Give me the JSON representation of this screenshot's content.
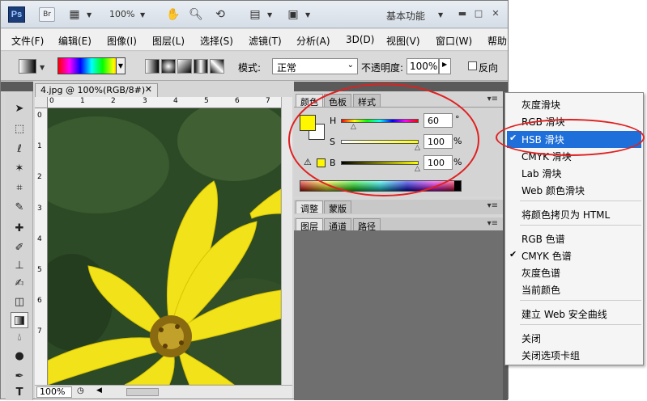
{
  "titlebar": {
    "logo": "Ps",
    "bridge": "Br",
    "zoom": "100%",
    "workspace": "基本功能"
  },
  "menubar": {
    "items": [
      "文件(F)",
      "编辑(E)",
      "图像(I)",
      "图层(L)",
      "选择(S)",
      "滤镜(T)",
      "分析(A)",
      "3D(D)",
      "视图(V)",
      "窗口(W)",
      "帮助"
    ]
  },
  "options": {
    "mode_label": "模式:",
    "mode_value": "正常",
    "opacity_label": "不透明度:",
    "opacity_value": "100%",
    "reverse_label": "反向"
  },
  "document": {
    "tab_title": "4.jpg @ 100%(RGB/8#)",
    "zoom": "100%",
    "ruler_h": [
      "0",
      "1",
      "2",
      "3",
      "4",
      "5",
      "6",
      "7"
    ],
    "ruler_v": [
      "0",
      "1",
      "2",
      "3",
      "4",
      "5",
      "6",
      "7"
    ]
  },
  "color_panel": {
    "tabs": [
      "颜色",
      "色板",
      "样式"
    ],
    "h_label": "H",
    "h_value": "60",
    "h_unit": "°",
    "s_label": "S",
    "s_value": "100",
    "s_unit": "%",
    "b_label": "B",
    "b_value": "100",
    "b_unit": "%",
    "fg_color": "#fff700"
  },
  "adjust_panel": {
    "tabs": [
      "调整",
      "蒙版"
    ]
  },
  "layers_panel": {
    "tabs": [
      "图层",
      "通道",
      "路径"
    ]
  },
  "context_menu": {
    "items": [
      {
        "label": "灰度滑块",
        "checked": false
      },
      {
        "label": "RGB 滑块",
        "checked": false
      },
      {
        "label": "HSB 滑块",
        "checked": true,
        "highlighted": true
      },
      {
        "label": "CMYK 滑块",
        "checked": false
      },
      {
        "label": "Lab 滑块",
        "checked": false
      },
      {
        "label": "Web 颜色滑块",
        "checked": false
      },
      {
        "label": "将颜色拷贝为 HTML",
        "checked": false
      },
      {
        "label": "RGB 色谱",
        "checked": false
      },
      {
        "label": "CMYK 色谱",
        "checked": true
      },
      {
        "label": "灰度色谱",
        "checked": false
      },
      {
        "label": "当前颜色",
        "checked": false
      },
      {
        "label": "建立 Web 安全曲线",
        "checked": false
      },
      {
        "label": "关闭",
        "checked": false
      },
      {
        "label": "关闭选项卡组",
        "checked": false
      }
    ]
  }
}
